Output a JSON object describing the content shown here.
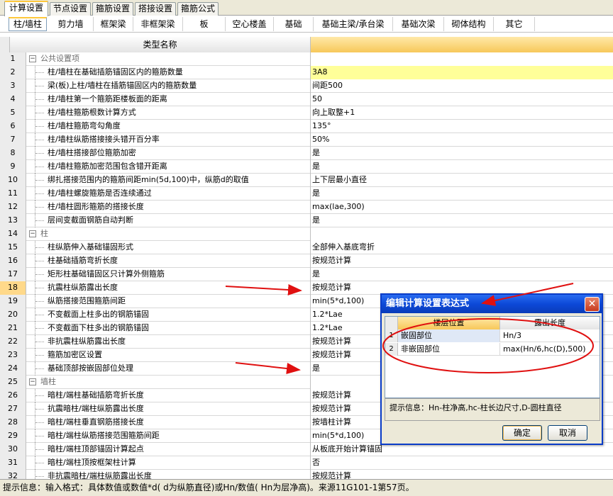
{
  "main_tabs": [
    "计算设置",
    "节点设置",
    "箍筋设置",
    "搭接设置",
    "箍筋公式"
  ],
  "sub_tabs": [
    "柱/墙柱",
    "剪力墙",
    "框架梁",
    "非框架梁",
    "板",
    "空心楼盖",
    "基础",
    "基础主梁/承台梁",
    "基础次梁",
    "砌体结构",
    "其它"
  ],
  "grid": {
    "header_name": "类型名称",
    "rows": [
      {
        "num": "1",
        "name": "公共设置项",
        "value": "",
        "group": true
      },
      {
        "num": "2",
        "name": "柱/墙柱在基础插筋锚固区内的箍筋数量",
        "value": "3A8",
        "highlight": true
      },
      {
        "num": "3",
        "name": "梁(板)上柱/墙柱在插筋锚固区内的箍筋数量",
        "value": "间距500"
      },
      {
        "num": "4",
        "name": "柱/墙柱第一个箍筋距楼板面的距离",
        "value": "50"
      },
      {
        "num": "5",
        "name": "柱/墙柱箍筋根数计算方式",
        "value": "向上取整+1"
      },
      {
        "num": "6",
        "name": "柱/墙柱箍筋弯勾角度",
        "value": "135°"
      },
      {
        "num": "7",
        "name": "柱/墙柱纵筋搭接接头错开百分率",
        "value": "50%"
      },
      {
        "num": "8",
        "name": "柱/墙柱搭接部位箍筋加密",
        "value": "是"
      },
      {
        "num": "9",
        "name": "柱/墙柱箍筋加密范围包含错开距离",
        "value": "是"
      },
      {
        "num": "10",
        "name": "绑扎搭接范围内的箍筋间距min(5d,100)中，纵筋d的取值",
        "value": "上下层最小直径"
      },
      {
        "num": "11",
        "name": "柱/墙柱螺旋箍筋是否连续通过",
        "value": "是"
      },
      {
        "num": "12",
        "name": "柱/墙柱圆形箍筋的搭接长度",
        "value": "max(lae,300)"
      },
      {
        "num": "13",
        "name": "层间变截面钢筋自动判断",
        "value": "是"
      },
      {
        "num": "14",
        "name": "柱",
        "value": "",
        "group": true
      },
      {
        "num": "15",
        "name": "柱纵筋伸入基础锚固形式",
        "value": "全部伸入基底弯折"
      },
      {
        "num": "16",
        "name": "柱基础插筋弯折长度",
        "value": "按规范计算"
      },
      {
        "num": "17",
        "name": "矩形柱基础锚固区只计算外侧箍筋",
        "value": "是"
      },
      {
        "num": "18",
        "name": "抗震柱纵筋露出长度",
        "value": "按规范计算",
        "selected": true
      },
      {
        "num": "19",
        "name": "纵筋搭接范围箍筋间距",
        "value": "min(5*d,100)"
      },
      {
        "num": "20",
        "name": "不变截面上柱多出的钢筋锚固",
        "value": "1.2*Lae"
      },
      {
        "num": "21",
        "name": "不变截面下柱多出的钢筋锚固",
        "value": "1.2*Lae"
      },
      {
        "num": "22",
        "name": "非抗震柱纵筋露出长度",
        "value": "按规范计算"
      },
      {
        "num": "23",
        "name": "箍筋加密区设置",
        "value": "按规范计算"
      },
      {
        "num": "24",
        "name": "基础顶部按嵌固部位处理",
        "value": "是"
      },
      {
        "num": "25",
        "name": "墙柱",
        "value": "",
        "group": true
      },
      {
        "num": "26",
        "name": "暗柱/端柱基础插筋弯折长度",
        "value": "按规范计算"
      },
      {
        "num": "27",
        "name": "抗震暗柱/端柱纵筋露出长度",
        "value": "按规范计算"
      },
      {
        "num": "28",
        "name": "暗柱/端柱垂直钢筋搭接长度",
        "value": "按墙柱计算"
      },
      {
        "num": "29",
        "name": "暗柱/端柱纵筋搭接范围箍筋间距",
        "value": "min(5*d,100)"
      },
      {
        "num": "30",
        "name": "暗柱/端柱顶部锚固计算起点",
        "value": "从板底开始计算锚固"
      },
      {
        "num": "31",
        "name": "暗柱/端柱顶按框架柱计算",
        "value": "否"
      },
      {
        "num": "32",
        "name": "非抗震暗柱/端柱纵筋露出长度",
        "value": "按规范计算"
      }
    ]
  },
  "status_text": "提示信息：输入格式：具体数值或数值*d( d为纵筋直径)或Hn/数值( Hn为层净高)。来源11G101-1第57页。",
  "dialog": {
    "title": "编辑计算设置表达式",
    "close": "✕",
    "col_position": "楼层位置",
    "col_length": "露出长度",
    "rows": [
      {
        "num": "1",
        "position": "嵌固部位",
        "length": "Hn/3"
      },
      {
        "num": "2",
        "position": "非嵌固部位",
        "length": "max(Hn/6,hc(D),500)"
      }
    ],
    "hint": "提示信息：Hn-柱净高,hc-柱长边尺寸,D-圆柱直径",
    "ok": "确定",
    "cancel": "取消"
  },
  "colors": {
    "annotation": "#e01010",
    "title_bar": "#0c49d8",
    "highlight": "#ffff99"
  }
}
